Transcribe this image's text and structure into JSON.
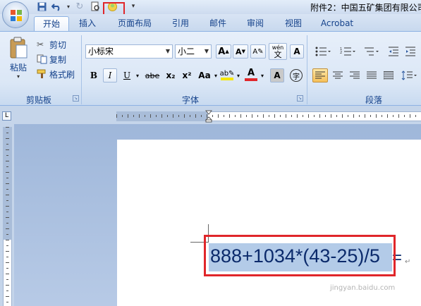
{
  "window": {
    "title": "附件2：中国五矿集团有限公司"
  },
  "tabs": [
    {
      "label": "开始",
      "active": true
    },
    {
      "label": "插入"
    },
    {
      "label": "页面布局"
    },
    {
      "label": "引用"
    },
    {
      "label": "邮件"
    },
    {
      "label": "审阅"
    },
    {
      "label": "视图"
    },
    {
      "label": "Acrobat"
    }
  ],
  "clipboard": {
    "group_label": "剪贴板",
    "paste_label": "粘贴",
    "cut_label": "剪切",
    "copy_label": "复制",
    "format_painter_label": "格式刷"
  },
  "font": {
    "group_label": "字体",
    "font_name": "小标宋",
    "font_size": "小二",
    "bold": "B",
    "italic": "I",
    "underline": "U",
    "strikethrough": "abe",
    "subscript": "x₂",
    "superscript": "x²",
    "change_case": "Aa",
    "grow_font": "A",
    "shrink_font": "A",
    "phonetic": "wén",
    "char_border": "A",
    "font_color": "A",
    "char_shading": "A",
    "enclose": "字"
  },
  "paragraph": {
    "group_label": "段落"
  },
  "document": {
    "formula": "888+1034*(43-25)/5",
    "trailing": "=",
    "watermark": "jingyan.baidu.com"
  },
  "colors": {
    "highlight": "#f5e600",
    "font_color": "#e0262a",
    "annotation": "#e0262a"
  }
}
